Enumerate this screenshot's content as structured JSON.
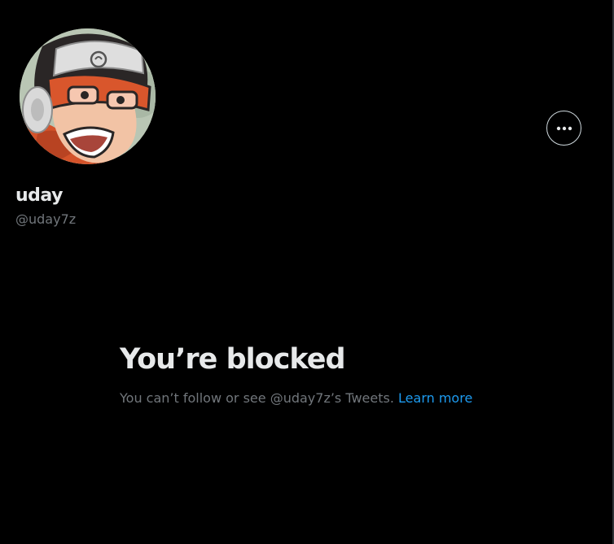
{
  "profile": {
    "display_name": "uday",
    "handle": "@uday7z",
    "avatar_icon": "anime-avatar-icon"
  },
  "header": {
    "more_icon": "more-horizontal-icon"
  },
  "blocked": {
    "title": "You’re blocked",
    "message": "You can’t follow or see @uday7z’s Tweets.",
    "link_label": "Learn more"
  },
  "colors": {
    "background": "#000000",
    "primary_text": "#e7e9ea",
    "secondary_text": "#71767b",
    "link": "#1d9bf0",
    "border": "#2f3336"
  }
}
